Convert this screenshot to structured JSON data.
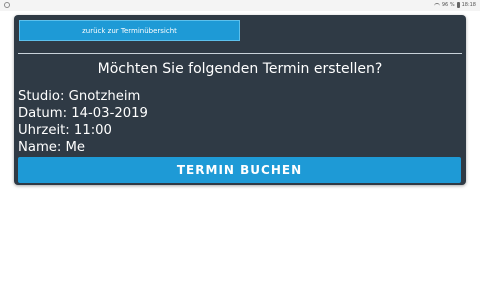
{
  "status_bar": {
    "battery_percent": "96 %",
    "time": "18:18"
  },
  "card": {
    "back_button_label": "zurück zur Terminübersicht",
    "question": "Möchten Sie folgenden Termin erstellen?",
    "details": {
      "studio": "Studio: Gnotzheim",
      "datum": "Datum: 14-03-2019",
      "uhrzeit": "Uhrzeit: 11:00",
      "name": "Name: Me"
    },
    "book_button_label": "TERMIN BUCHEN"
  },
  "colors": {
    "card_background": "#2f3a45",
    "accent": "#1e9ad6",
    "text": "#ffffff"
  }
}
